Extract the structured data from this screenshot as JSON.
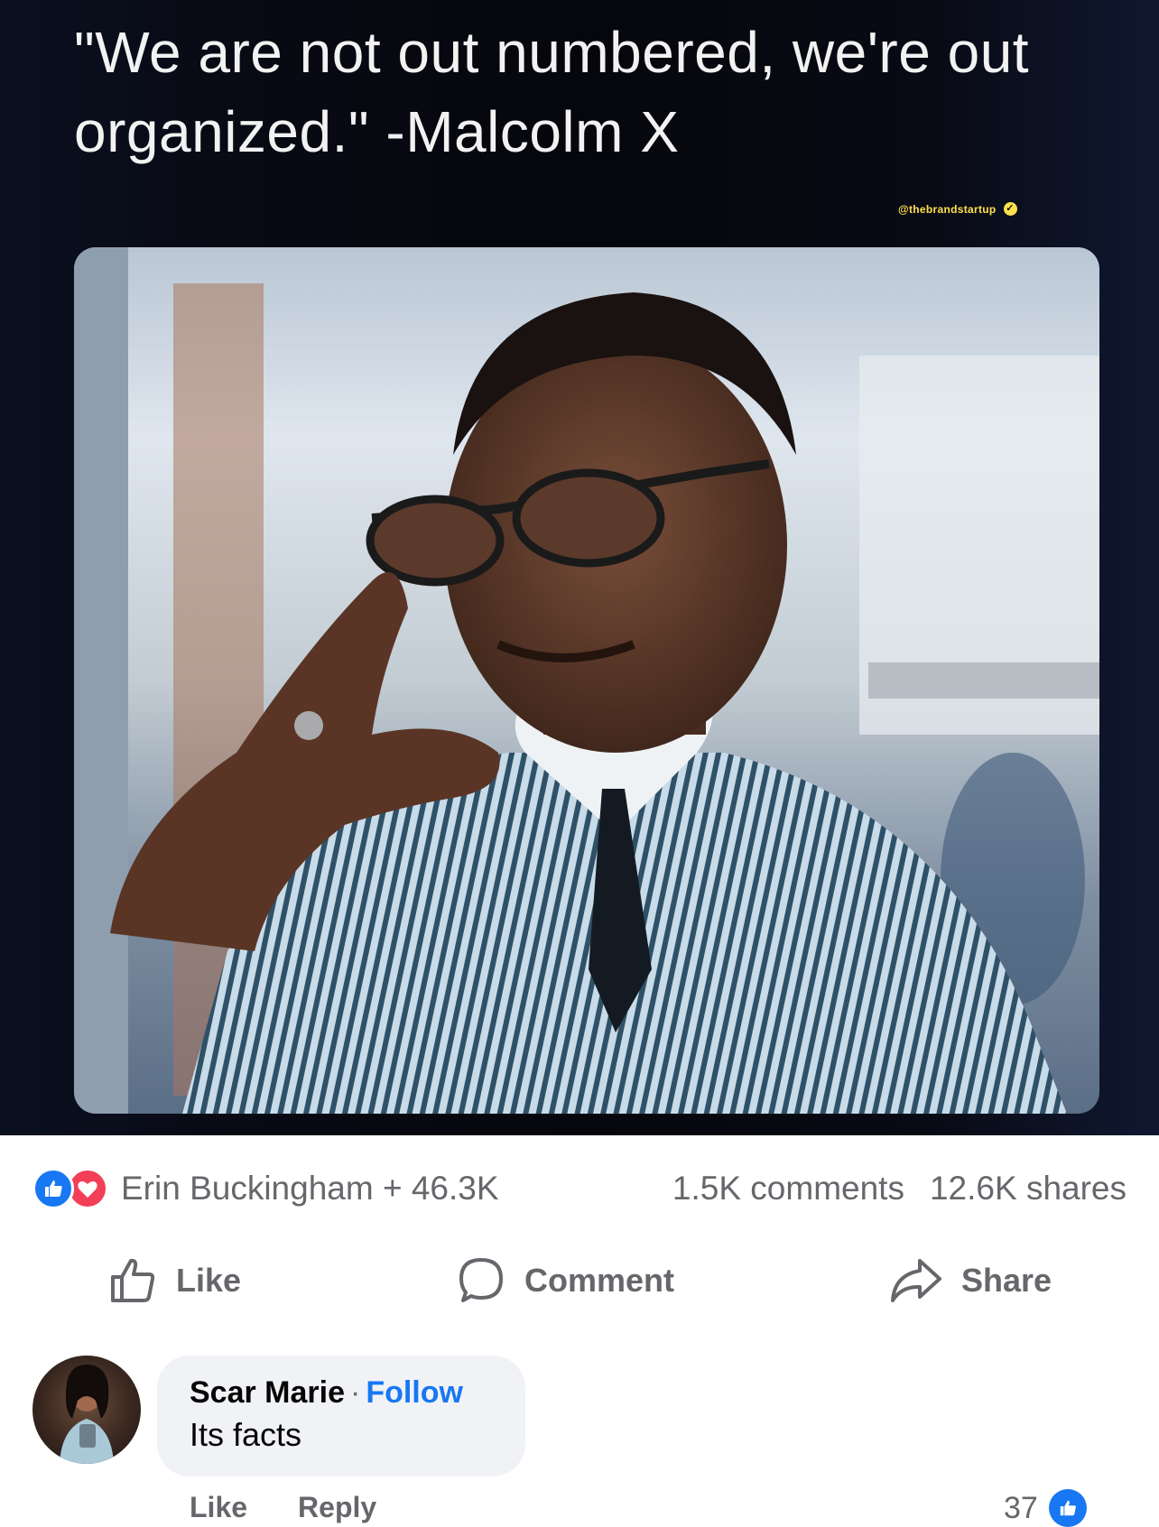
{
  "post": {
    "quote_text": "\"We are not out numbered, we're out organized.\" -Malcolm X",
    "watermark": "@thebrandstartup"
  },
  "reactions": {
    "summary": "Erin Buckingham + 46.3K",
    "comments": "1.5K comments",
    "shares": "12.6K shares",
    "like_color": "#1877f2",
    "love_color": "#f33e58"
  },
  "actions": {
    "like": "Like",
    "comment": "Comment",
    "share": "Share"
  },
  "comment": {
    "author": "Scar Marie",
    "separator": "·",
    "follow": "Follow",
    "text": "Its facts",
    "like": "Like",
    "reply": "Reply",
    "like_count": "37"
  }
}
